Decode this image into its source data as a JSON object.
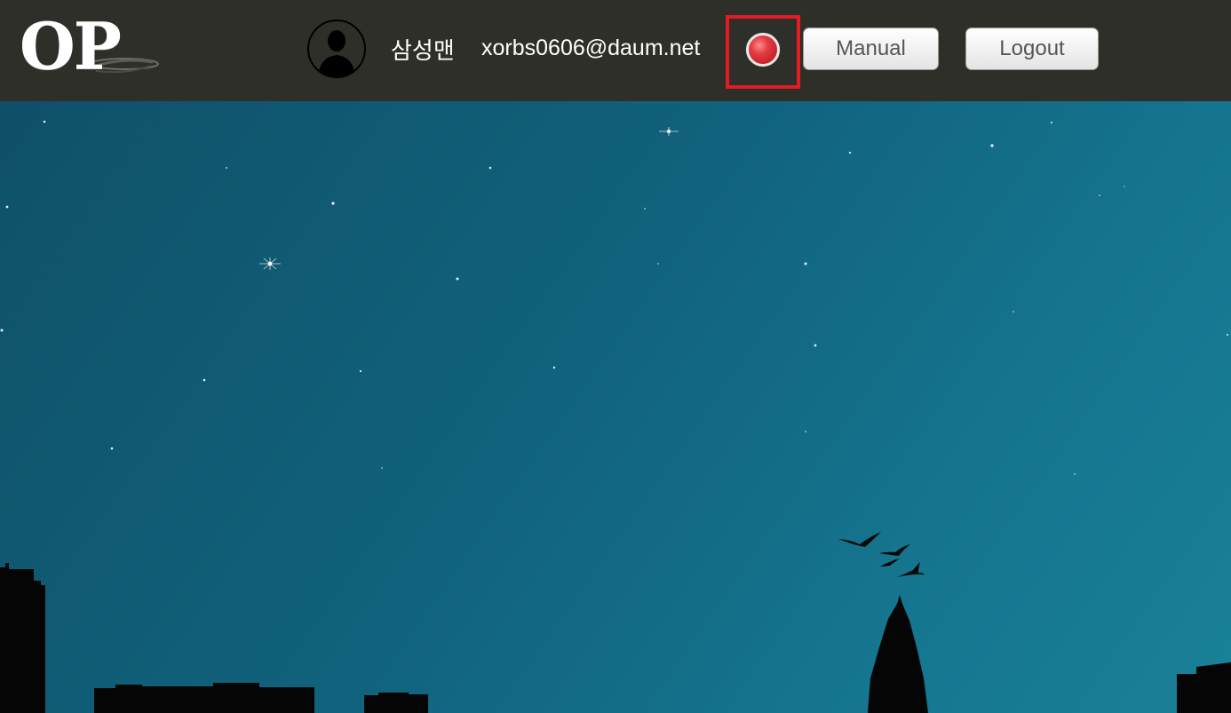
{
  "header": {
    "logo_text": "OP",
    "user": {
      "name": "삼성맨",
      "email": "xorbs0606@daum.net"
    },
    "status_indicator": {
      "icon": "status-dot-icon",
      "color": "#d92b32"
    },
    "highlight_color": "#e21b24",
    "buttons": {
      "manual_label": "Manual",
      "logout_label": "Logout"
    }
  },
  "background": {
    "description_icon": "night-city-skyline",
    "sky_color": "#12617a",
    "header_color": "#2f2f2a"
  }
}
